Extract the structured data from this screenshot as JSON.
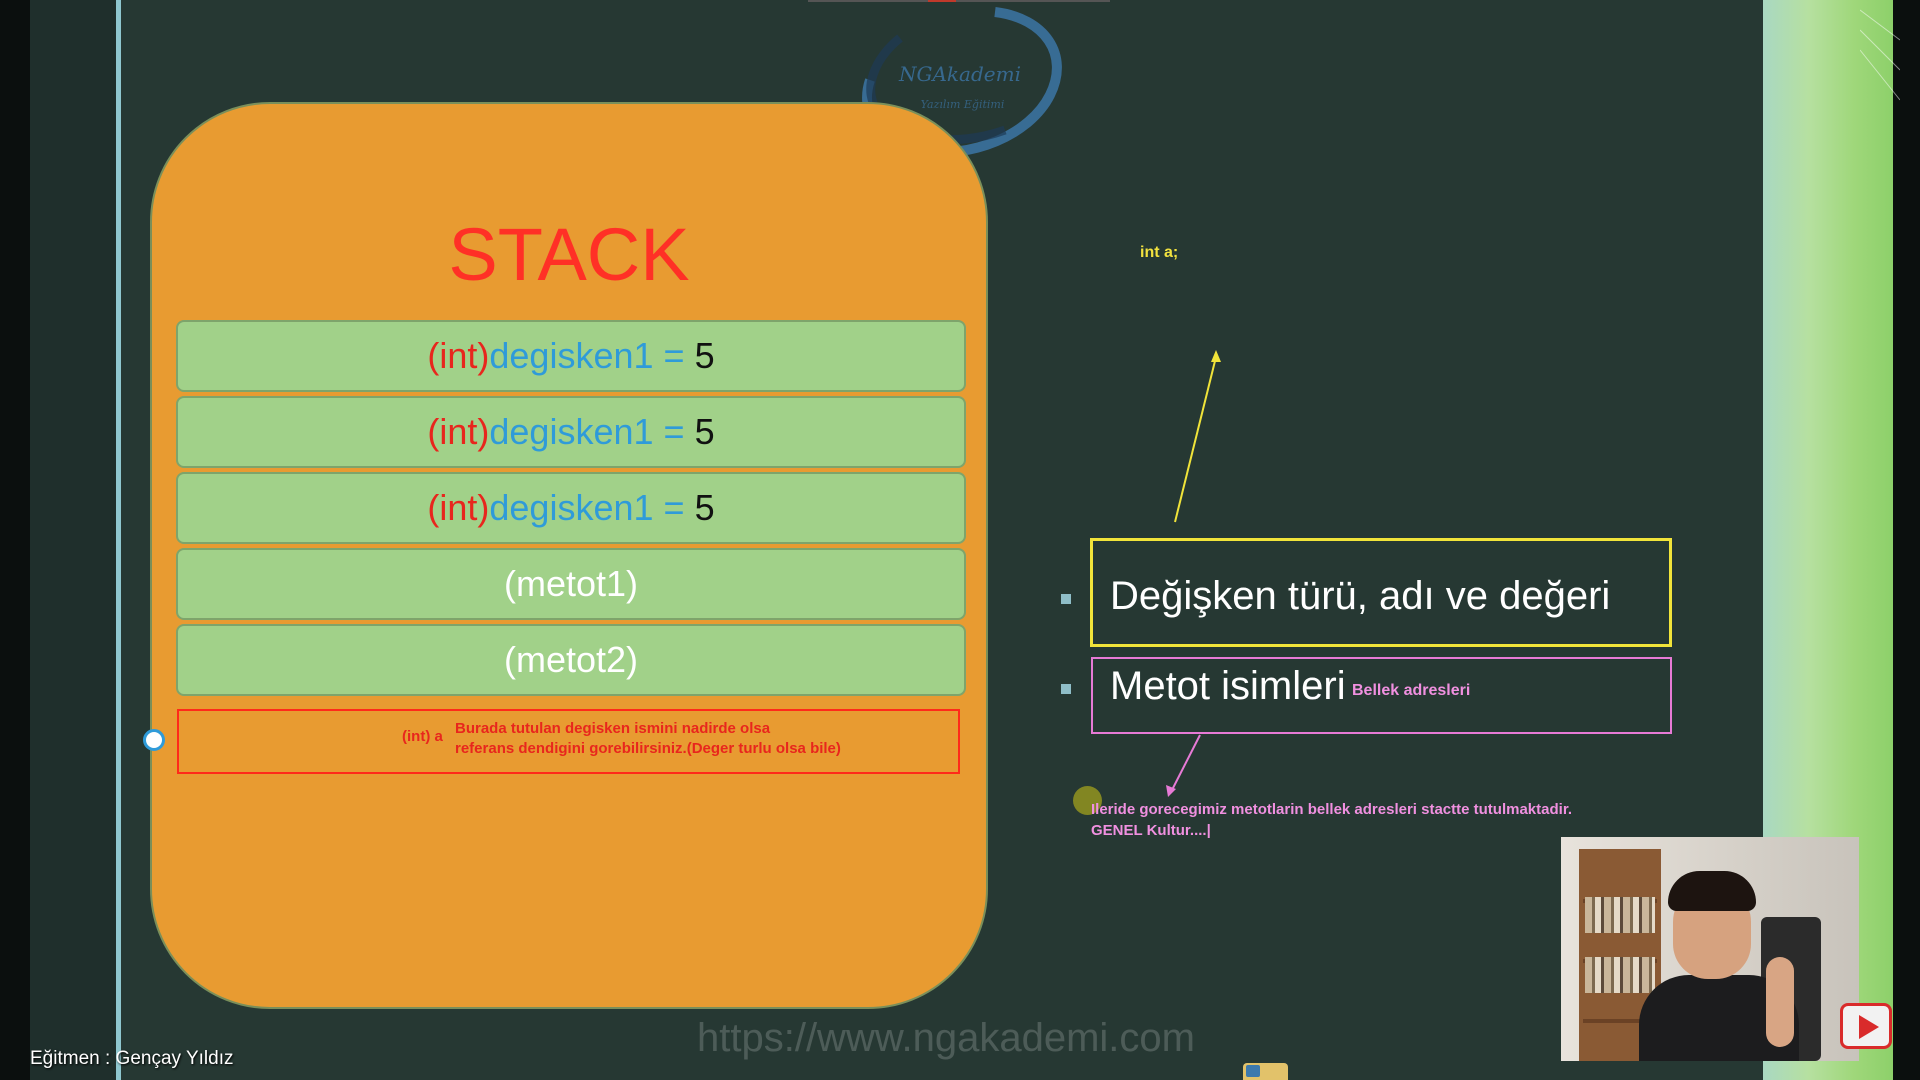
{
  "stack": {
    "title": "STACK",
    "rows": [
      {
        "type": "(int)",
        "name": "degisken1",
        "eq": "=",
        "value": "5"
      },
      {
        "type": "(int)",
        "name": "degisken1",
        "eq": "=",
        "value": "5"
      },
      {
        "type": "(int)",
        "name": "degisken1",
        "eq": "=",
        "value": "5"
      }
    ],
    "methods": [
      "(metot1)",
      "(metot2)"
    ],
    "reference": {
      "label": "(int) a",
      "line1": "Burada tutulan degisken ismini nadirde olsa",
      "line2": "referans dendigini gorebilirsiniz.(Deger turlu olsa bile)"
    }
  },
  "logo": {
    "text": "NGAkademi",
    "subtext": "Yazılım Eğitimi"
  },
  "annotations": {
    "int_a": "int a;",
    "bullet1": "Değişken türü, adı ve değeri",
    "bullet2": "Metot isimleri",
    "bellek": "Bellek adresleri",
    "note_line1": "Ileride gorecegimiz metotlarin bellek adresleri stactte tutulmaktadir.",
    "note_line2": "GENEL Kultur....|"
  },
  "footer": {
    "website": "https://www.ngakademi.com",
    "instructor": "Eğitmen : Gençay Yıldız"
  },
  "colors": {
    "stack_bg": "#e89b31",
    "row_bg": "#a1d189",
    "keyword": "#e8261d",
    "variable": "#2f9bd9",
    "highlight_yellow": "#f1e43a",
    "highlight_pink": "#e77ad6"
  },
  "icons": [
    "cursor-circle-icon",
    "youtube-icon",
    "app-tray-icon"
  ]
}
